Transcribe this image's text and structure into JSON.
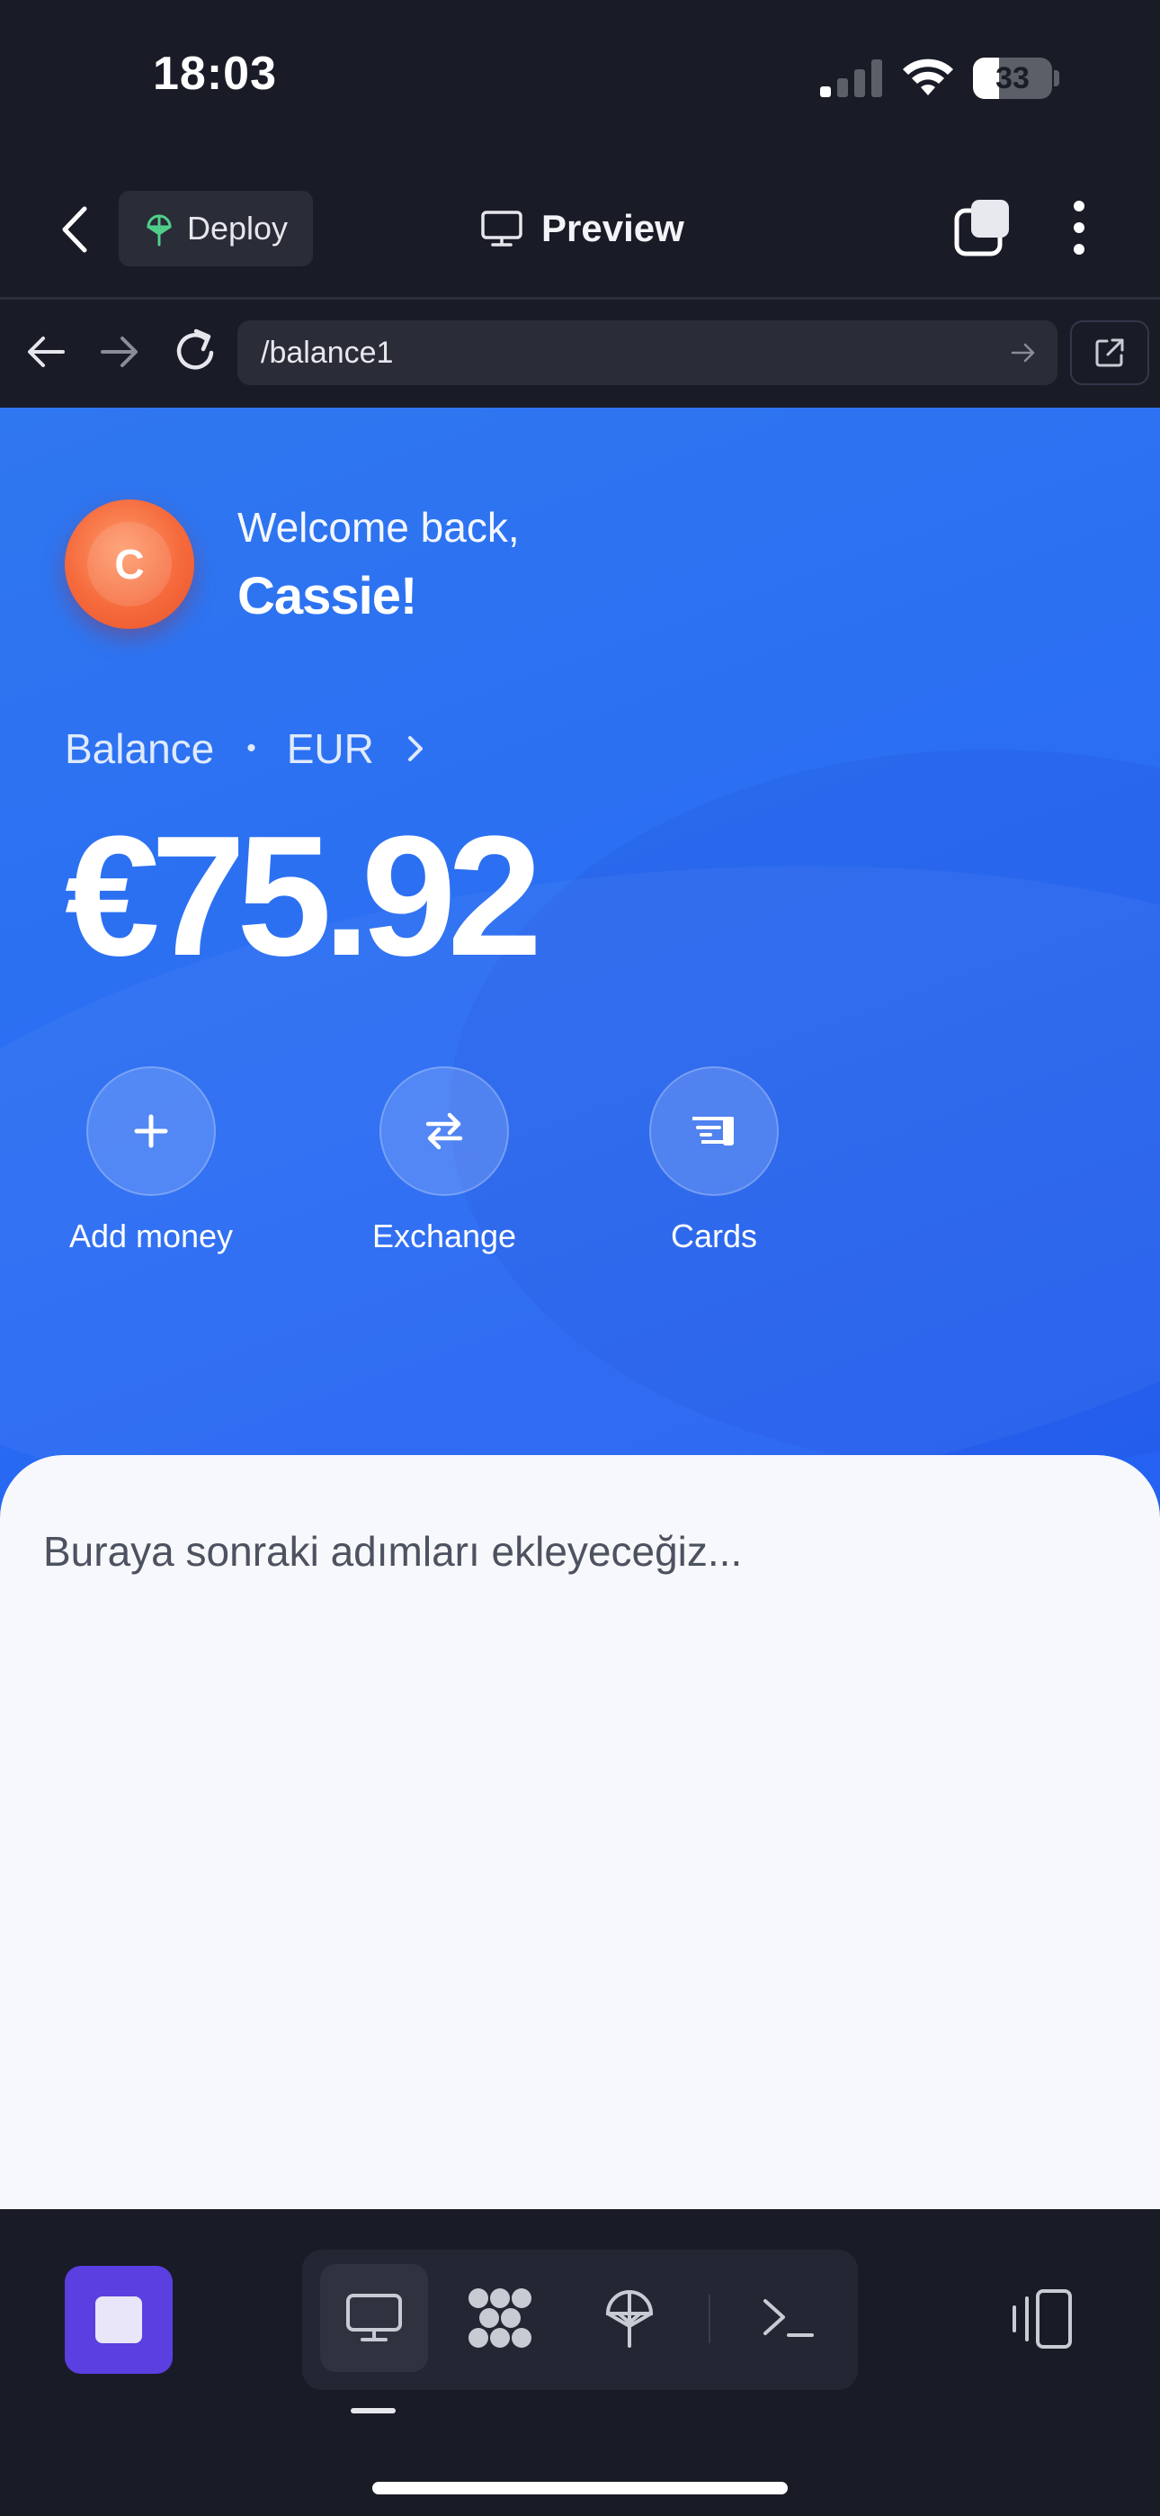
{
  "status_bar": {
    "time": "18:03",
    "battery_level": "33",
    "battery_fraction": 0.33
  },
  "header": {
    "deploy_label": "Deploy",
    "title": "Preview",
    "icons": {
      "back": "chevron-left-icon",
      "deploy": "deploy-tree-icon",
      "preview": "monitor-icon",
      "tabs": "tabs-icon",
      "more": "more-vertical-icon"
    }
  },
  "browser": {
    "url": "/balance1",
    "icons": {
      "back": "arrow-left-icon",
      "forward": "arrow-right-icon",
      "reload": "reload-icon",
      "go": "arrow-right-icon",
      "open_external": "external-link-icon"
    }
  },
  "page": {
    "avatar_initial": "C",
    "welcome": "Welcome back,",
    "user_name": "Cassie!",
    "balance_label": "Balance",
    "separator": "•",
    "currency": "EUR",
    "balance_amount": "€75.92",
    "actions": [
      {
        "label": "Add money",
        "icon": "plus-icon"
      },
      {
        "label": "Exchange",
        "icon": "exchange-icon"
      },
      {
        "label": "Cards",
        "icon": "card-icon"
      }
    ],
    "placeholder_text": "Buraya sonraki adımları ekleyeceğiz...",
    "colors": {
      "gradient_start": "#2f77f0",
      "gradient_end": "#1f55f0",
      "avatar": "#f56a3c",
      "panel": "#f7f8fb"
    }
  },
  "toolbar": {
    "stop_color": "#5b3fe0",
    "modes": [
      {
        "name": "preview",
        "icon": "monitor-icon",
        "active": true
      },
      {
        "name": "code",
        "icon": "agent-icon",
        "active": false
      },
      {
        "name": "deploy",
        "icon": "deploy-tree-icon",
        "active": false
      },
      {
        "name": "terminal",
        "icon": "terminal-icon",
        "active": false
      }
    ],
    "device_icon": "device-toggle-icon"
  }
}
